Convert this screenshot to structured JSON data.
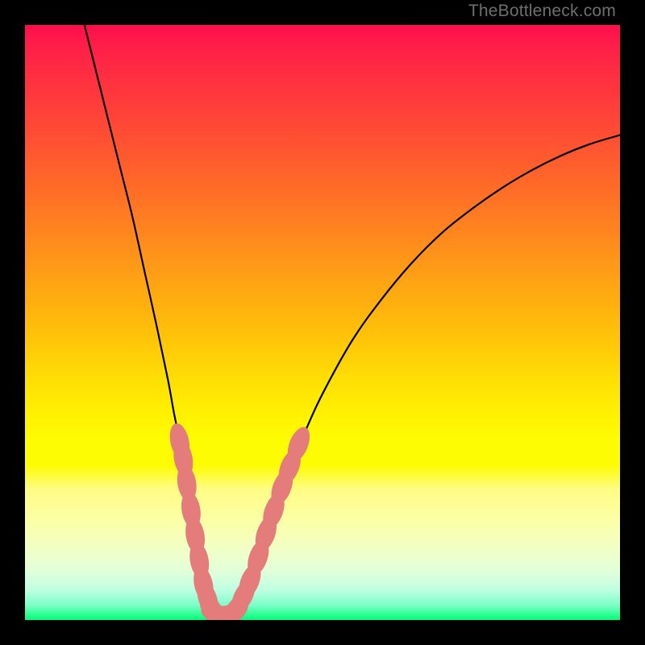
{
  "watermark": "TheBottleneck.com",
  "chart_data": {
    "type": "line",
    "title": "",
    "xlabel": "",
    "ylabel": "",
    "xlim": [
      0,
      100
    ],
    "ylim": [
      0,
      100
    ],
    "series": [
      {
        "name": "main-curve",
        "points": [
          [
            10.0,
            100.0
          ],
          [
            12.0,
            92.0
          ],
          [
            14.0,
            84.0
          ],
          [
            16.0,
            76.0
          ],
          [
            18.0,
            68.0
          ],
          [
            20.0,
            59.0
          ],
          [
            22.0,
            50.0
          ],
          [
            24.0,
            40.5
          ],
          [
            25.0,
            35.0
          ],
          [
            26.0,
            30.0
          ],
          [
            27.0,
            24.0
          ],
          [
            28.0,
            18.0
          ],
          [
            29.0,
            12.0
          ],
          [
            30.0,
            6.0
          ],
          [
            31.0,
            2.5
          ],
          [
            32.0,
            1.2
          ],
          [
            33.0,
            0.8
          ],
          [
            34.0,
            0.8
          ],
          [
            35.0,
            1.4
          ],
          [
            36.0,
            2.5
          ],
          [
            37.0,
            4.5
          ],
          [
            38.0,
            7.0
          ],
          [
            40.0,
            13.0
          ],
          [
            42.0,
            19.0
          ],
          [
            44.0,
            24.5
          ],
          [
            47.0,
            31.5
          ],
          [
            50.0,
            38.0
          ],
          [
            55.0,
            47.0
          ],
          [
            60.0,
            54.0
          ],
          [
            65.0,
            60.0
          ],
          [
            70.0,
            65.0
          ],
          [
            75.0,
            69.0
          ],
          [
            80.0,
            72.5
          ],
          [
            85.0,
            75.5
          ],
          [
            90.0,
            78.0
          ],
          [
            95.0,
            80.0
          ],
          [
            100.0,
            81.5
          ]
        ]
      }
    ],
    "markers": [
      {
        "x": 26.0,
        "y": 30.0
      },
      {
        "x": 26.6,
        "y": 27.1
      },
      {
        "x": 27.2,
        "y": 23.0
      },
      {
        "x": 27.9,
        "y": 18.5
      },
      {
        "x": 28.6,
        "y": 14.2
      },
      {
        "x": 29.3,
        "y": 10.0
      },
      {
        "x": 30.0,
        "y": 6.0
      },
      {
        "x": 30.7,
        "y": 3.6
      },
      {
        "x": 31.3,
        "y": 2.0
      },
      {
        "x": 32.0,
        "y": 1.2
      },
      {
        "x": 32.6,
        "y": 0.9
      },
      {
        "x": 33.3,
        "y": 0.8
      },
      {
        "x": 34.0,
        "y": 0.9
      },
      {
        "x": 34.7,
        "y": 1.1
      },
      {
        "x": 35.5,
        "y": 1.8
      },
      {
        "x": 36.7,
        "y": 4.0
      },
      {
        "x": 37.8,
        "y": 6.5
      },
      {
        "x": 39.2,
        "y": 10.5
      },
      {
        "x": 40.5,
        "y": 14.5
      },
      {
        "x": 41.8,
        "y": 18.3
      },
      {
        "x": 43.2,
        "y": 22.3
      },
      {
        "x": 44.5,
        "y": 25.7
      },
      {
        "x": 46.0,
        "y": 29.5
      }
    ],
    "marker_style": {
      "color": "#e47c7c",
      "radius": 2.0
    }
  }
}
